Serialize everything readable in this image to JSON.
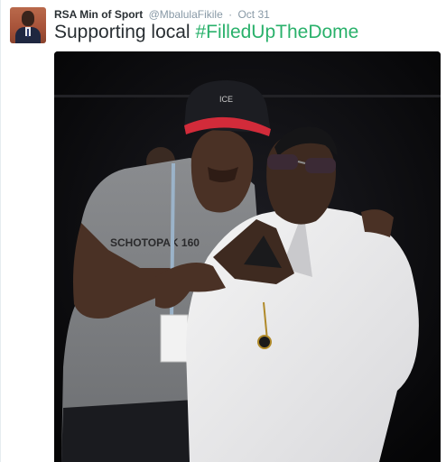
{
  "tweet": {
    "author_name": "RSA Min of Sport",
    "handle": "@MbalulaFikile",
    "separator": "·",
    "time": "Oct 31",
    "text": "Supporting local ",
    "hashtag": "#FilledUpTheDome",
    "avatar_icon": "profile-photo",
    "hashtag_color": "#2ab16b"
  },
  "photo": {
    "cap_emblem": "ICE",
    "shirt_print": "SCHOTOPAK 160"
  }
}
